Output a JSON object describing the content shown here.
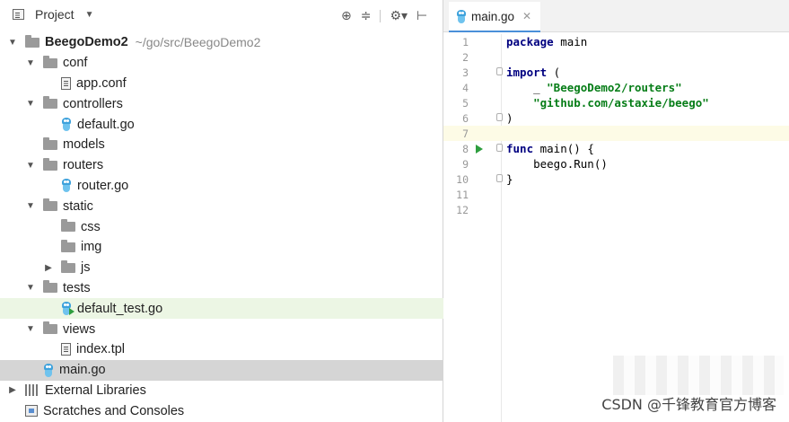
{
  "project_panel": {
    "title": "Project",
    "tree": [
      {
        "label": "BeegoDemo2",
        "hint": "~/go/src/BeegoDemo2",
        "type": "folder",
        "depth": 0,
        "arrow": "down",
        "bold": true
      },
      {
        "label": "conf",
        "type": "folder",
        "depth": 1,
        "arrow": "down"
      },
      {
        "label": "app.conf",
        "type": "file",
        "depth": 2
      },
      {
        "label": "controllers",
        "type": "folder",
        "depth": 1,
        "arrow": "down"
      },
      {
        "label": "default.go",
        "type": "go",
        "depth": 2
      },
      {
        "label": "models",
        "type": "folder",
        "depth": 1
      },
      {
        "label": "routers",
        "type": "folder",
        "depth": 1,
        "arrow": "down"
      },
      {
        "label": "router.go",
        "type": "go",
        "depth": 2
      },
      {
        "label": "static",
        "type": "folder",
        "depth": 1,
        "arrow": "down"
      },
      {
        "label": "css",
        "type": "folder",
        "depth": 2
      },
      {
        "label": "img",
        "type": "folder",
        "depth": 2
      },
      {
        "label": "js",
        "type": "folder",
        "depth": 2,
        "arrow": "right"
      },
      {
        "label": "tests",
        "type": "folder",
        "depth": 1,
        "arrow": "down"
      },
      {
        "label": "default_test.go",
        "type": "gotest",
        "depth": 2,
        "highlight": "green"
      },
      {
        "label": "views",
        "type": "folder",
        "depth": 1,
        "arrow": "down"
      },
      {
        "label": "index.tpl",
        "type": "file",
        "depth": 2
      },
      {
        "label": "main.go",
        "type": "go",
        "depth": 1,
        "highlight": "grey"
      },
      {
        "label": "External Libraries",
        "type": "libs",
        "depth": 0,
        "arrow": "right"
      },
      {
        "label": "Scratches and Consoles",
        "type": "scratch",
        "depth": 0
      }
    ]
  },
  "editor": {
    "tab_label": "main.go",
    "lines": [
      {
        "n": "1",
        "html": "<span class=\"kw\">package</span> main"
      },
      {
        "n": "2",
        "html": ""
      },
      {
        "n": "3",
        "html": "<span class=\"kw\">import</span> (",
        "fold": true
      },
      {
        "n": "4",
        "html": "    _ <span class=\"str\">\"BeegoDemo2/routers\"</span>"
      },
      {
        "n": "5",
        "html": "    <span class=\"str\">\"github.com/astaxie/beego\"</span>"
      },
      {
        "n": "6",
        "html": ")",
        "fold": true
      },
      {
        "n": "7",
        "html": "",
        "current": true
      },
      {
        "n": "8",
        "html": "<span class=\"kw\">func</span> main() {",
        "fold": true,
        "run": true
      },
      {
        "n": "9",
        "html": "    beego.Run()"
      },
      {
        "n": "10",
        "html": "}",
        "fold": true
      },
      {
        "n": "11",
        "html": ""
      },
      {
        "n": "12",
        "html": ""
      }
    ]
  },
  "watermark": "CSDN @千锋教育官方博客",
  "colors": {
    "accent": "#4a8fd9",
    "selected_row": "#d5d5d5",
    "test_row": "#ecf6e4",
    "keyword": "#000080",
    "string": "#067d17"
  }
}
